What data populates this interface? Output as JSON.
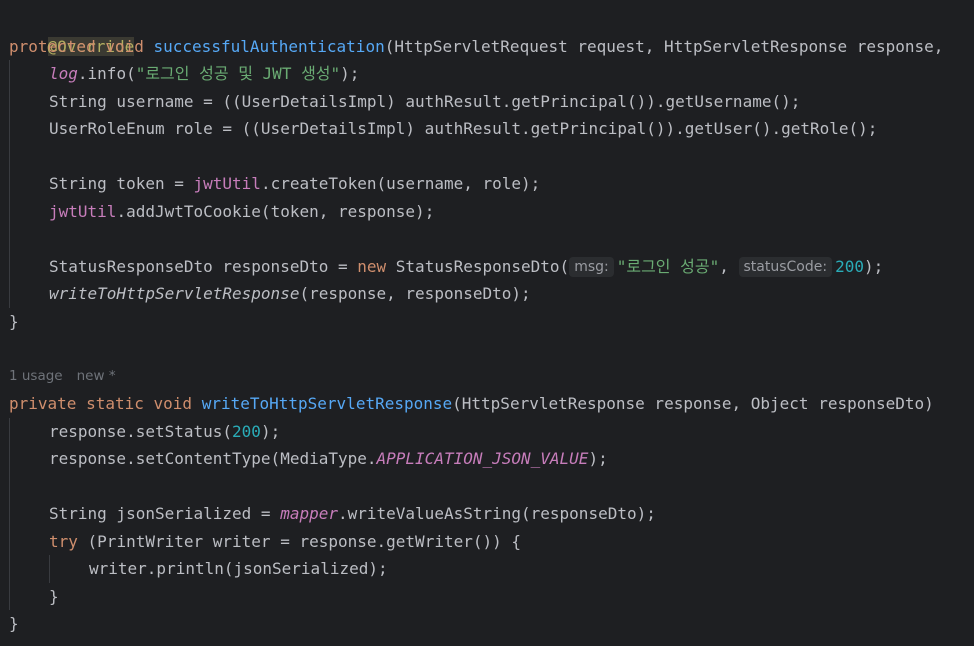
{
  "editor": {
    "l1": {
      "anno": "@Override"
    },
    "l2": {
      "kw1": "protected",
      "kw2": "void",
      "method": "successfulAuthentication",
      "rest": "(HttpServletRequest request, HttpServletResponse response,"
    },
    "l3": {
      "field": "log",
      "rest1": ".info(",
      "str": "\"로그인 성공 및 JWT 생성\"",
      "rest2": ");"
    },
    "l4": {
      "text": "String username = ((UserDetailsImpl) authResult.getPrincipal()).getUsername();"
    },
    "l5": {
      "text": "UserRoleEnum role = ((UserDetailsImpl) authResult.getPrincipal()).getUser().getRole();"
    },
    "l6": {
      "pre": "String token = ",
      "field": "jwtUtil",
      "rest": ".createToken(username, role);"
    },
    "l7": {
      "field": "jwtUtil",
      "rest": ".addJwtToCookie(token, response);"
    },
    "l8": {
      "pre": "StatusResponseDto responseDto = ",
      "kw": "new",
      "mid": " StatusResponseDto(",
      "hint1": "msg:",
      "str": "\"로그인 성공\"",
      "comma": ", ",
      "hint2": "statusCode:",
      "num": "200",
      "end": ");"
    },
    "l9": {
      "call": "writeToHttpServletResponse",
      "rest": "(response, responseDto);"
    },
    "l10": {
      "brace": "}"
    },
    "lens": {
      "usage": "1 usage",
      "author": "new *"
    },
    "l11": {
      "kw1": "private",
      "kw2": "static",
      "kw3": "void",
      "method": "writeToHttpServletResponse",
      "rest": "(HttpServletResponse response, Object responseDto)"
    },
    "l12": {
      "pre": "response.setStatus(",
      "num": "200",
      "end": ");"
    },
    "l13": {
      "pre": "response.setContentType(MediaType.",
      "const": "APPLICATION_JSON_VALUE",
      "end": ");"
    },
    "l14": {
      "pre": "String jsonSerialized = ",
      "field": "mapper",
      "rest": ".writeValueAsString(responseDto);"
    },
    "l15": {
      "kw": "try",
      "rest": " (PrintWriter writer = response.getWriter()) {"
    },
    "l16": {
      "text": "writer.println(jsonSerialized);"
    },
    "l17": {
      "brace": "}"
    },
    "l18": {
      "brace": "}"
    }
  }
}
